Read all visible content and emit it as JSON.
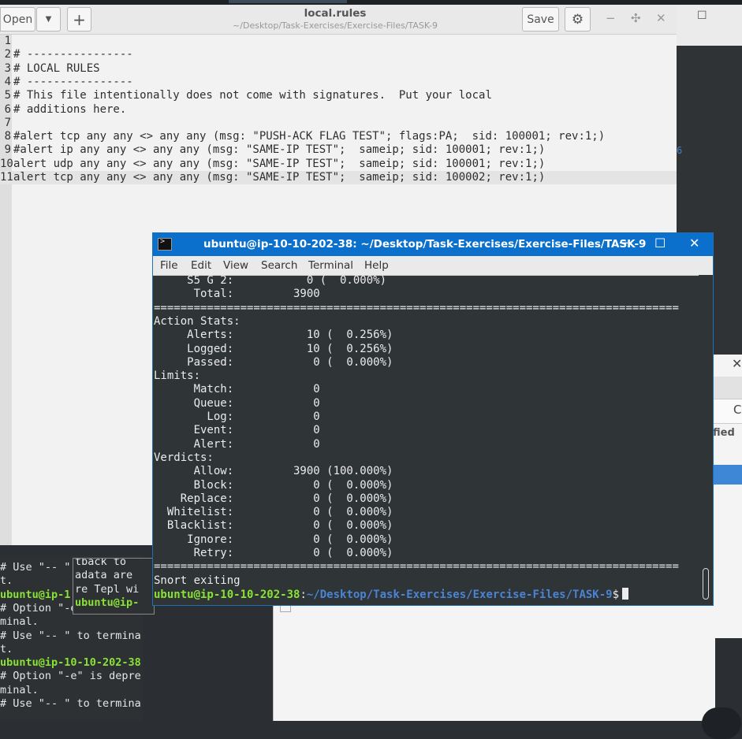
{
  "editor": {
    "open_label": "Open",
    "new_tab_symbol": "+",
    "save_label": "Save",
    "title": "local.rules",
    "path": "~/Desktop/Task-Exercises/Exercise-Files/TASK-9",
    "lines": [
      {
        "n": "1",
        "text": ""
      },
      {
        "n": "2",
        "text": "# ----------------"
      },
      {
        "n": "3",
        "text": "# LOCAL RULES"
      },
      {
        "n": "4",
        "text": "# ----------------"
      },
      {
        "n": "5",
        "text": "# This file intentionally does not come with signatures.  Put your local"
      },
      {
        "n": "6",
        "text": "# additions here."
      },
      {
        "n": "7",
        "text": ""
      },
      {
        "n": "8",
        "text": "#alert tcp any any <> any any (msg: \"PUSH-ACK FLAG TEST\"; flags:PA;  sid: 100001; rev:1;)"
      },
      {
        "n": "9",
        "text": "#alert ip any any <> any any (msg: \"SAME-IP TEST\";  sameip; sid: 100001; rev:1;)"
      },
      {
        "n": "10",
        "text": "alert udp any any <> any any (msg: \"SAME-IP TEST\";  sameip; sid: 100001; rev:1;)"
      },
      {
        "n": "11",
        "text": "alert tcp any any <> any any (msg: \"SAME-IP TEST\";  sameip; sid: 100002; rev:1;)"
      }
    ]
  },
  "terminal": {
    "title": "ubuntu@ip-10-10-202-38: ~/Desktop/Task-Exercises/Exercise-Files/TASK-9",
    "menu": [
      "File",
      "Edit",
      "View",
      "Search",
      "Terminal",
      "Help"
    ],
    "lines": [
      "     S5 G 2:           0 (  0.000%)",
      "      Total:         3900",
      "===============================================================================",
      "Action Stats:",
      "     Alerts:           10 (  0.256%)",
      "     Logged:           10 (  0.256%)",
      "     Passed:            0 (  0.000%)",
      "Limits:",
      "      Match:            0",
      "      Queue:            0",
      "        Log:            0",
      "      Event:            0",
      "      Alert:            0",
      "Verdicts:",
      "      Allow:         3900 (100.000%)",
      "      Block:            0 (  0.000%)",
      "    Replace:            0 (  0.000%)",
      "  Whitelist:            0 (  0.000%)",
      "  Blacklist:            0 (  0.000%)",
      "     Ignore:            0 (  0.000%)",
      "      Retry:            0 (  0.000%)",
      "===============================================================================",
      "Snort exiting"
    ],
    "prompt_user": "ubuntu@ip-10-10-202-38",
    "prompt_sep": ":",
    "prompt_path": "~/Desktop/Task-Exercises/Exercise-Files/TASK-9",
    "prompt_symbol": "$"
  },
  "bg_terminal_left": {
    "lines": [
      {
        "text": "# Use \"-- \"",
        "green": false
      },
      {
        "text": "t.",
        "green": false
      },
      {
        "text": "ubuntu@ip-1",
        "green": true
      },
      {
        "text": "# Option \"-e",
        "green": false
      },
      {
        "text": "minal.",
        "green": false
      },
      {
        "text": "# Use \"-- \" to termina",
        "green": false
      },
      {
        "text": "t.",
        "green": false
      },
      {
        "text": "ubuntu@ip-10-10-202-38",
        "green": true
      },
      {
        "text": "# Option \"-e\" is depre",
        "green": false
      },
      {
        "text": "minal.",
        "green": false
      },
      {
        "text": "# Use \"-- \" to termina",
        "green": false
      }
    ]
  },
  "bg_terminal_small": {
    "lines": [
      {
        "text": "tback to",
        "green": false
      },
      {
        "text": "adata are",
        "green": false
      },
      {
        "text": "re Tepl wi",
        "green": false
      },
      {
        "text": "ubuntu@ip-",
        "green": true
      }
    ]
  },
  "bg_right": {
    "partial_label": "fied",
    "partial_char": "C",
    "blue_mark": "6"
  }
}
